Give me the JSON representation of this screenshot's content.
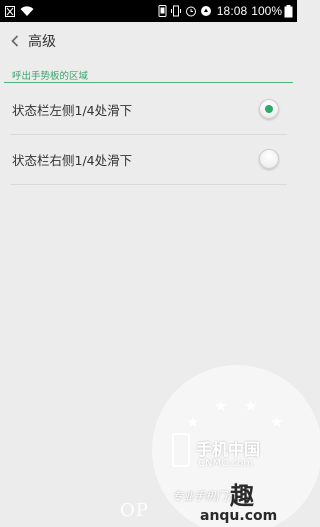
{
  "status_bar": {
    "time": "18:08",
    "battery": "100%",
    "icons": [
      "sim-off-icon",
      "wifi-icon",
      "screenshot-icon",
      "vibrate-icon",
      "alarm-icon",
      "data-sync-icon",
      "battery-icon"
    ]
  },
  "header": {
    "back_icon": "chevron-left-icon",
    "title": "高级"
  },
  "section": {
    "title": "呼出手势板的区域"
  },
  "options": [
    {
      "label": "状态栏左侧1/4处滑下",
      "selected": true
    },
    {
      "label": "状态栏右侧1/4处滑下",
      "selected": false
    }
  ],
  "watermark": {
    "site_cn": "手机中国",
    "site_en": "CNMO.com",
    "slogan": "专业手机门户",
    "big_char": "趣",
    "url": "anqu.com",
    "brand_fragment": "OP"
  },
  "colors": {
    "accent": "#3aa46b",
    "radio_selected": "#2fa86a",
    "background": "#ececec"
  }
}
